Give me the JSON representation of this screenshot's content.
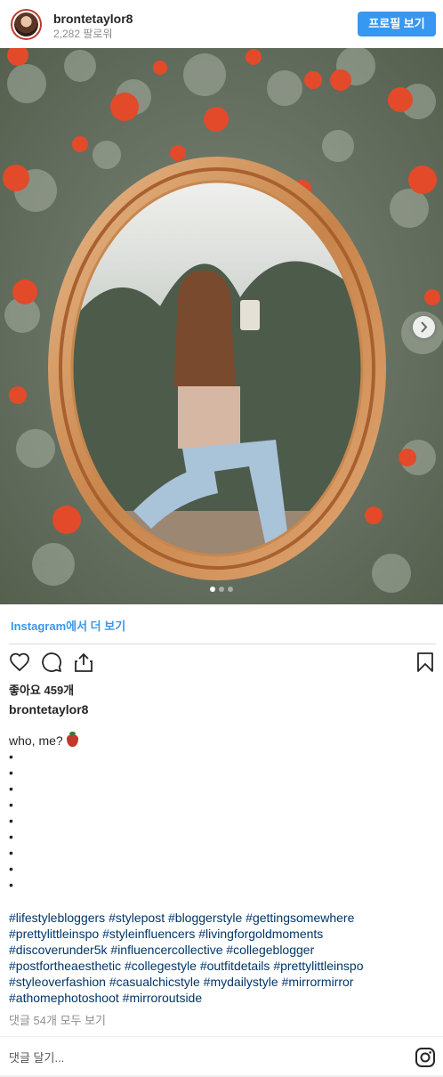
{
  "header": {
    "username": "brontetaylor8",
    "followers": "2,282 팔로워",
    "profile_button": "프로필 보기"
  },
  "post": {
    "more_link": "Instagram에서 더 보기",
    "likes": "좋아요 459개",
    "caption_user": "brontetaylor8",
    "caption_lines": [
      "who, me?",
      "•",
      "•",
      "•",
      "•",
      "•",
      "•",
      "•",
      "•",
      "•"
    ],
    "hashtags": [
      "#lifestylebloggers",
      "#stylepost",
      "#bloggerstyle",
      "#gettingsomewhere",
      "#prettylittleinspo",
      "#styleinfluencers",
      "#livingforgoldmoments",
      "#discoverunder5k",
      "#influencercollective",
      "#collegeblogger",
      "#postfortheaesthetic",
      "#collegestyle",
      "#outfitdetails",
      "#prettylittleinspo",
      "#styleoverfashion",
      "#casualchicstyle",
      "#mydailystyle",
      "#mirrormirror",
      "#athomephotoshoot",
      "#mirroroutside"
    ],
    "comments_link": "댓글 54개 모두 보기",
    "comment_placeholder": "댓글 달기..."
  },
  "carousel": {
    "current": 1,
    "total": 3
  },
  "icons": [
    "heart-icon",
    "comment-icon",
    "share-icon",
    "bookmark-icon",
    "chevron-right-icon",
    "instagram-icon"
  ],
  "colors": {
    "accent": "#3897f0",
    "hashtag": "#003569",
    "muted": "#8e8e8e"
  }
}
